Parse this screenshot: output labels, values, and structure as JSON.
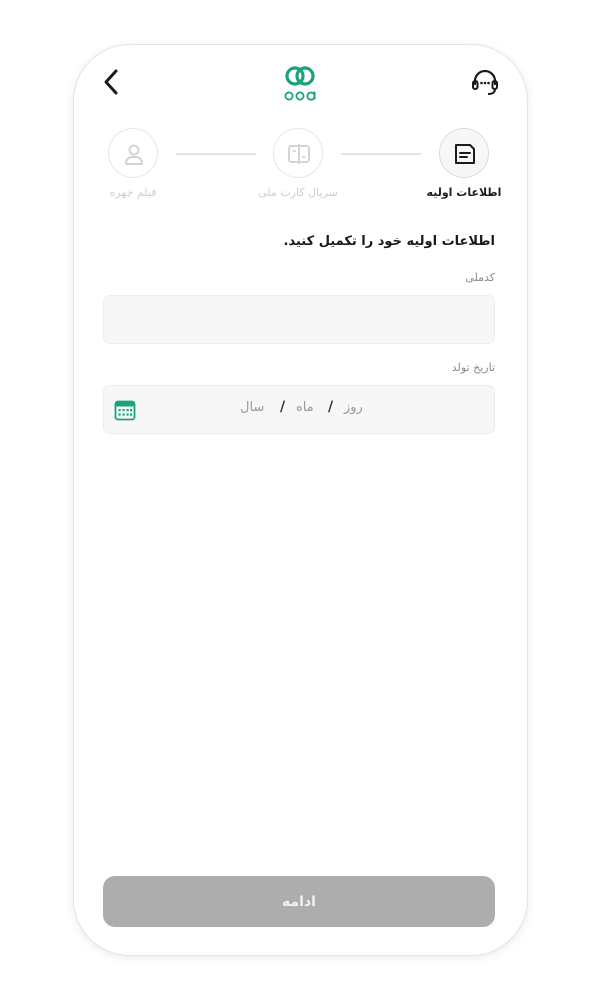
{
  "header": {
    "back_icon": "chevron-left-icon",
    "logo_text": "pod",
    "support_icon": "headset-icon"
  },
  "steps": [
    {
      "label": "اطلاعات اولیه",
      "icon": "document-icon",
      "active": true
    },
    {
      "label": "سریال کارت ملی",
      "icon": "id-card-icon",
      "active": false
    },
    {
      "label": "فیلم چهره",
      "icon": "user-icon",
      "active": false
    }
  ],
  "form": {
    "heading": "اطلاعات اولیه خود را تکمیل کنید.",
    "national_code": {
      "label": "کدملی",
      "value": ""
    },
    "birth_date": {
      "label": "تاریخ تولد",
      "day_placeholder": "روز",
      "month_placeholder": "ماه",
      "year_placeholder": "سال",
      "separator": "/",
      "icon": "calendar-icon"
    }
  },
  "footer": {
    "continue_label": "ادامه"
  },
  "colors": {
    "brand_green": "#1aa37a",
    "button_disabled": "#adadad",
    "input_bg": "#f7f7f7"
  }
}
